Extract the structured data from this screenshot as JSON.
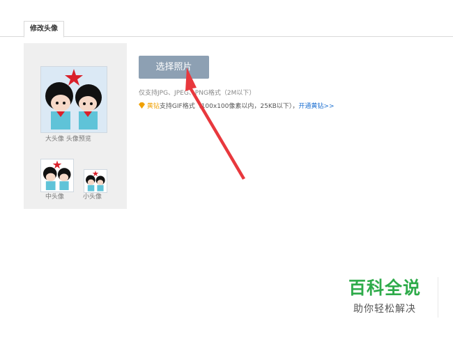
{
  "tab": {
    "label": "修改头像"
  },
  "preview": {
    "large_caption": "大头像 头像预览",
    "medium_caption": "中头像",
    "small_caption": "小头像"
  },
  "upload": {
    "button_label": "选择照片",
    "format_hint": "仅支持JPG、JPEG、PNG格式（2M以下）",
    "vip_label": "黄钻",
    "vip_hint": "支持GIF格式（100x100像素以内，25KB以下），",
    "vip_link": "开通黄钻>>"
  },
  "watermark": {
    "title": "百科全说",
    "subtitle": "助你轻松解决"
  },
  "colors": {
    "button": "#8da0b3",
    "link": "#1b6fd1",
    "vip": "#f0a000",
    "arrow": "#e8383d",
    "watermark": "#2eab4a"
  }
}
